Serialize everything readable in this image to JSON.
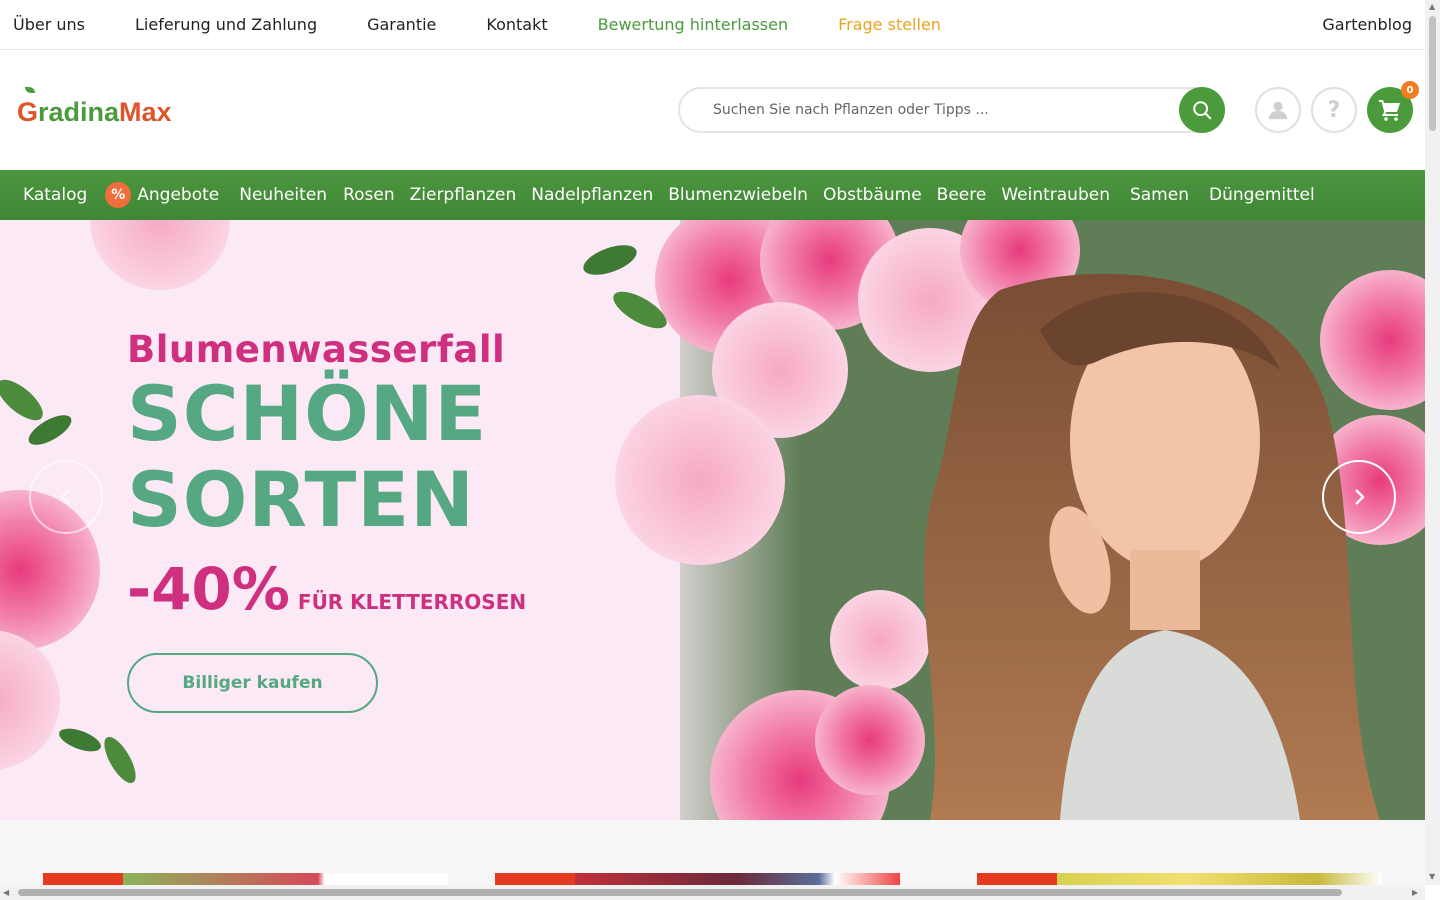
{
  "top_links": {
    "about": "Über uns",
    "delivery": "Lieferung und Zahlung",
    "warranty": "Garantie",
    "contact": "Kontakt",
    "review": "Bewertung hinterlassen",
    "question": "Frage stellen",
    "blog": "Gartenblog"
  },
  "header": {
    "logo_g": "G",
    "logo_adina": "radina",
    "logo_max": "Max",
    "search_placeholder": "Suchen Sie nach Pflanzen oder Tipps ...",
    "help_label": "?",
    "cart_count": "0"
  },
  "nav": {
    "items": [
      {
        "label": "Katalog"
      },
      {
        "label": "Angebote",
        "badge": "%"
      },
      {
        "label": "Neuheiten"
      },
      {
        "label": "Rosen"
      },
      {
        "label": "Zierpflanzen"
      },
      {
        "label": "Nadelpflanzen"
      },
      {
        "label": "Blumenzwiebeln"
      },
      {
        "label": "Obstbäume"
      },
      {
        "label": "Beere"
      },
      {
        "label": "Weintrauben"
      },
      {
        "label": "Samen"
      },
      {
        "label": "Düngemittel"
      }
    ]
  },
  "hero": {
    "tagline": "Blumenwasserfall",
    "headline_1": "SCHÖNE",
    "headline_2": "SORTEN",
    "discount": "-40%",
    "discount_note": "FÜR KLETTERROSEN",
    "cta": "Billiger kaufen"
  },
  "colors": {
    "brand_green": "#4b9a3c",
    "brand_orange": "#e0542a",
    "hero_pink": "#cf2f7f",
    "hero_green": "#55a882"
  }
}
